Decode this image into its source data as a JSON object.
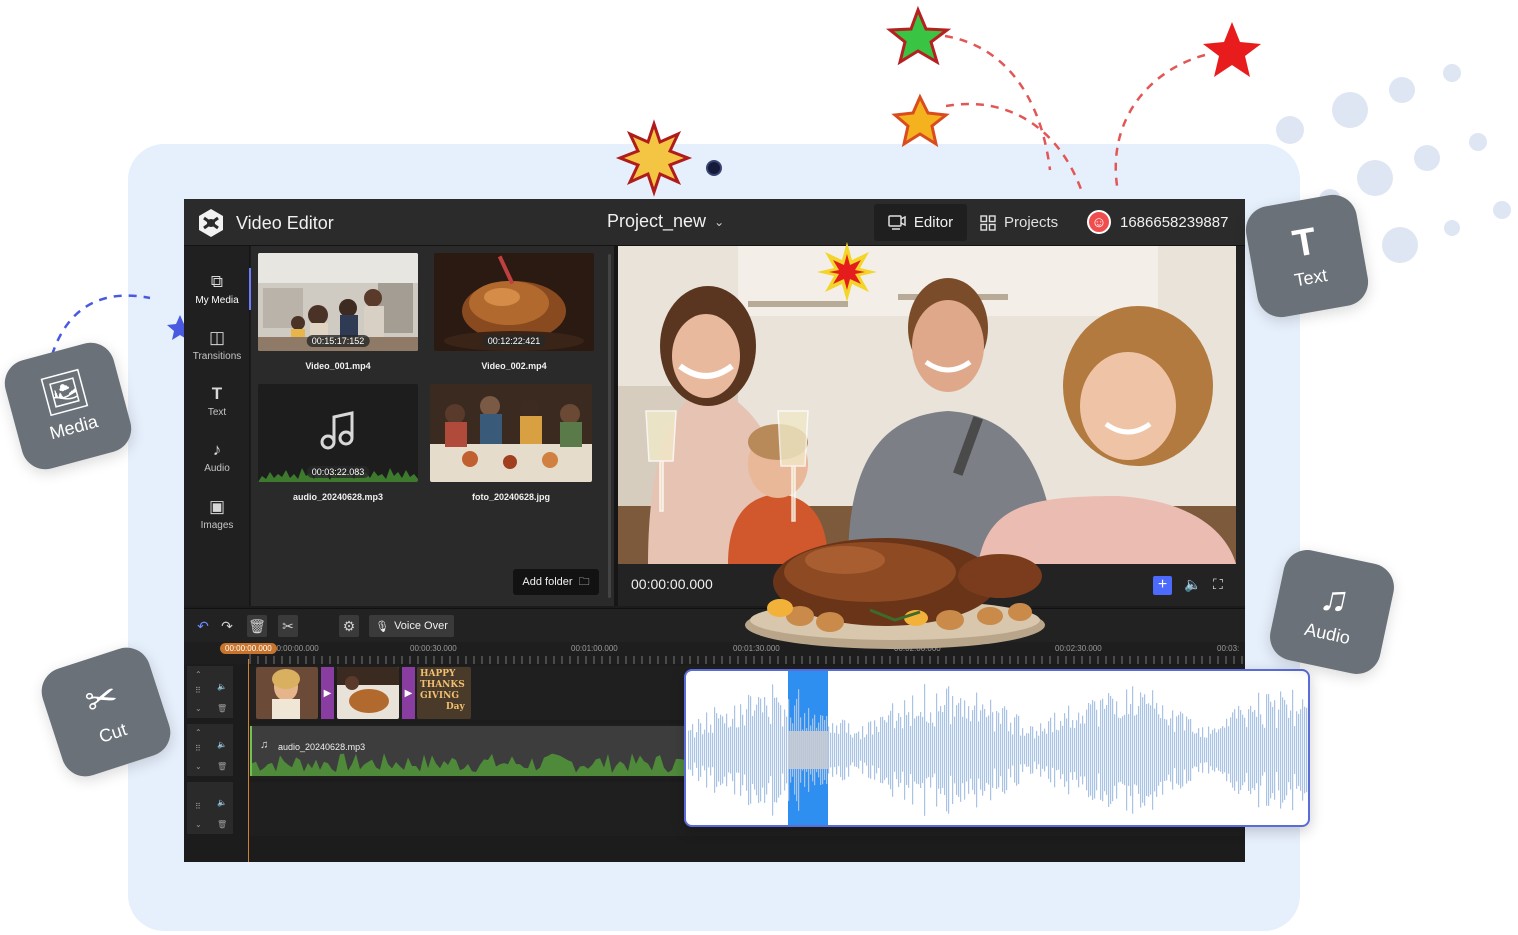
{
  "app": {
    "name": "Video Editor",
    "project": "Project_new",
    "modes": {
      "editor": "Editor",
      "projects": "Projects"
    },
    "user": "1686658239887"
  },
  "rail": [
    {
      "label": "My Media",
      "icon": "media-import-icon",
      "active": true
    },
    {
      "label": "Transitions",
      "icon": "transitions-icon"
    },
    {
      "label": "Text",
      "icon": "text-icon"
    },
    {
      "label": "Audio",
      "icon": "music-note-icon"
    },
    {
      "label": "Images",
      "icon": "image-icon"
    }
  ],
  "media": [
    {
      "name": "Video_001.mp4",
      "duration": "00:15:17:152",
      "kind": "video"
    },
    {
      "name": "Video_002.mp4",
      "duration": "00:12:22:421",
      "kind": "video"
    },
    {
      "name": "audio_20240628.mp3",
      "duration": "00:03:22.083",
      "kind": "audio"
    },
    {
      "name": "foto_20240628.jpg",
      "kind": "image"
    }
  ],
  "media_panel": {
    "add_folder": "Add folder"
  },
  "preview": {
    "timecode": "00:00:00.000"
  },
  "timeline": {
    "voice_over": "Voice Over",
    "playhead": "00:00:00.000",
    "ruler": [
      "00:00:00.000",
      "00:00:30.000",
      "00:01:00.000",
      "00:01:30.000",
      "00:02:00.000",
      "00:02:30.000",
      "00:03:"
    ],
    "audio_clip": "audio_20240628.mp3",
    "title_card": [
      "HAPPY",
      "THANKS",
      "GIVING",
      "Day"
    ]
  },
  "tiles": {
    "media": "Media",
    "text": "Text",
    "audio": "Audio",
    "cut": "Cut"
  },
  "colors": {
    "accent": "#4d6aff",
    "playhead": "#c9742c",
    "transition": "#8a3da0",
    "waveform": "#a9c3e6",
    "selection": "#2f8ff0"
  }
}
